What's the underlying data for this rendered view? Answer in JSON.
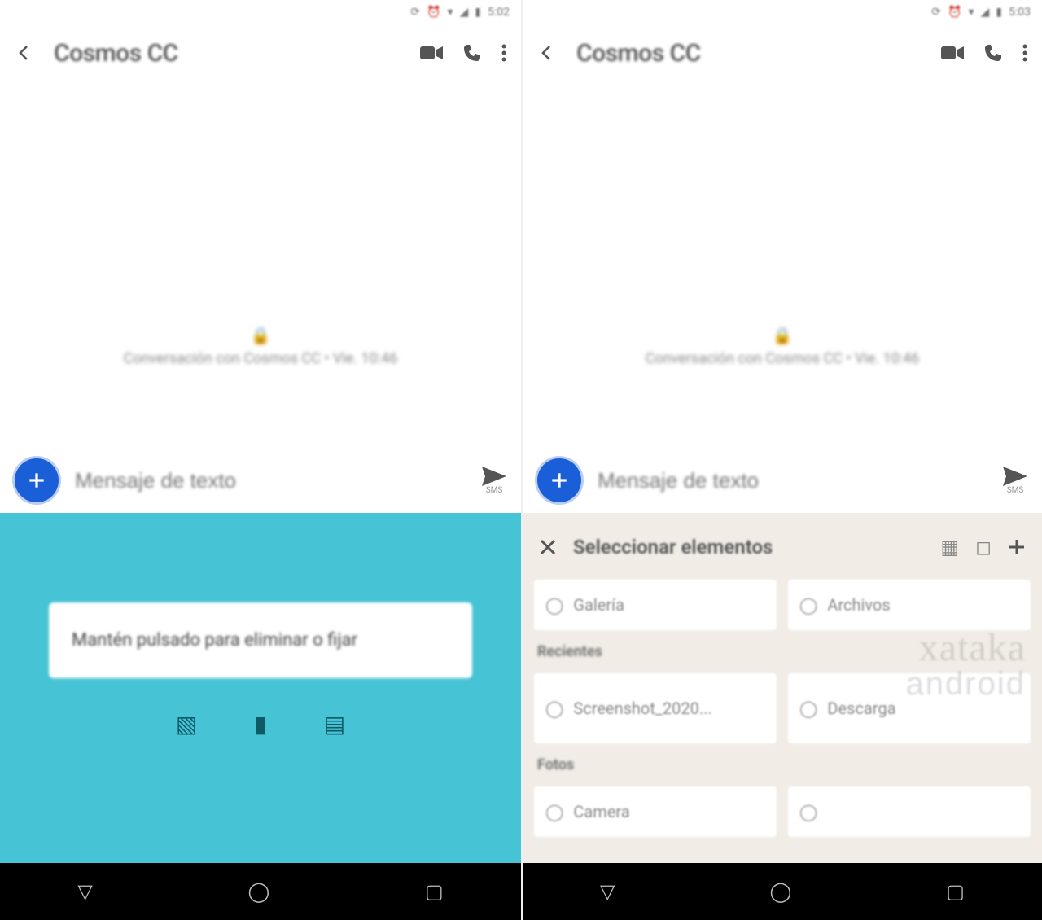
{
  "left": {
    "status_time": "5:02",
    "contact": "Cosmos CC",
    "meta": "Conversación con Cosmos CC • Vie. 10:46",
    "input_placeholder": "Mensaje de texto",
    "send_sub": "SMS",
    "hint": "Mantén pulsado para eliminar o fijar"
  },
  "right": {
    "status_time": "5:03",
    "contact": "Cosmos CC",
    "meta": "Conversación con Cosmos CC • Vie. 10:46",
    "input_placeholder": "Mensaje de texto",
    "send_sub": "SMS",
    "picker_title": "Seleccionar elementos",
    "section_recent": "Recientes",
    "section_photos": "Fotos",
    "tile1": "Galería",
    "tile2": "Archivos",
    "tile3": "Screenshot_2020...",
    "tile4": "Descarga",
    "tile5": "Camera"
  },
  "watermark": {
    "l1": "xataka",
    "l2": "android"
  }
}
